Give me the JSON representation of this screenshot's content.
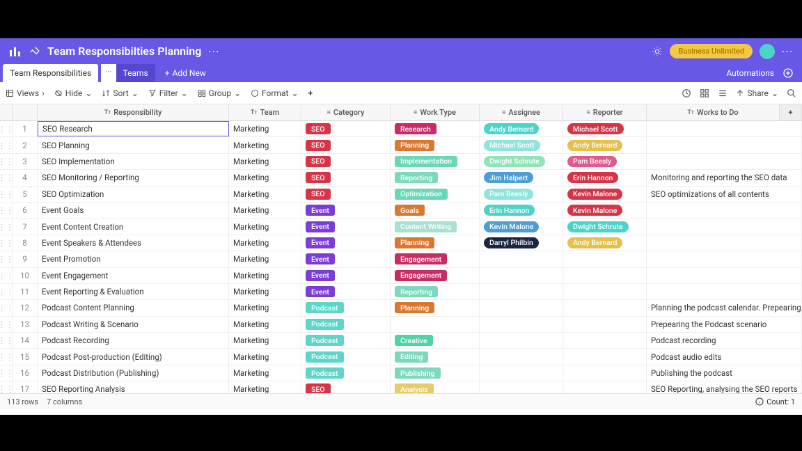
{
  "titlebar": {
    "title": "Team Responsibilties Planning",
    "badge": "Business Unlimited"
  },
  "tabs": {
    "active": "Team Responsibilities",
    "other": "Teams",
    "add_new": "Add New",
    "automations": "Automations"
  },
  "toolbar": {
    "views": "Views",
    "hide": "Hide",
    "sort": "Sort",
    "filter": "Filter",
    "group": "Group",
    "format": "Format",
    "share": "Share"
  },
  "columns": {
    "responsibility": "Responsibility",
    "team": "Team",
    "category": "Category",
    "work_type": "Work Type",
    "assignee": "Assignee",
    "reporter": "Reporter",
    "works": "Works to Do"
  },
  "colors": {
    "seo": "#d63447",
    "event": "#7a3dd8",
    "podcast": "#5cd6c8",
    "research": "#c72c66",
    "planning": "#d97830",
    "implementation": "#6ad8b8",
    "reporting": "#7dd8c0",
    "optimization": "#6ad8b8",
    "goals": "#d97830",
    "contentwriting": "#a8e0d4",
    "engagement": "#c72c66",
    "creative": "#4dd4a8",
    "editing": "#7dd8c0",
    "publishing": "#7dd8c0",
    "analysis": "#e5cc66",
    "p_teal": "#4dd4c8",
    "p_lightteal": "#8fe5dc",
    "p_yellow": "#e5c04d",
    "p_red": "#d63447",
    "p_orange": "#e88a3c",
    "p_blue": "#4d9ed4",
    "p_pink": "#e05a8c",
    "p_navy": "#1a2740",
    "p_lightgreen": "#8fe5b8"
  },
  "rows": [
    {
      "n": "1",
      "resp": "SEO Research",
      "team": "Marketing",
      "category": "SEO",
      "catColor": "seo",
      "workType": "Research",
      "wtColor": "research",
      "assignee": "Andy Bernard",
      "asColor": "p_teal",
      "reporter": "Michael Scott",
      "repColor": "p_red",
      "works": ""
    },
    {
      "n": "2",
      "resp": "SEO Planning",
      "team": "Marketing",
      "category": "SEO",
      "catColor": "seo",
      "workType": "Planning",
      "wtColor": "planning",
      "assignee": "Michael Scott",
      "asColor": "p_lightteal",
      "reporter": "Andy Bernard",
      "repColor": "p_yellow",
      "works": ""
    },
    {
      "n": "3",
      "resp": "SEO Implementation",
      "team": "Marketing",
      "category": "SEO",
      "catColor": "seo",
      "workType": "Implementation",
      "wtColor": "implementation",
      "assignee": "Dwight Schrute",
      "asColor": "p_lightgreen",
      "reporter": "Pam Beesly",
      "repColor": "p_pink",
      "works": ""
    },
    {
      "n": "4",
      "resp": "SEO Monitoring / Reporting",
      "team": "Marketing",
      "category": "SEO",
      "catColor": "seo",
      "workType": "Reporting",
      "wtColor": "reporting",
      "assignee": "Jim Halpert",
      "asColor": "p_blue",
      "reporter": "Erin Hannon",
      "repColor": "p_red",
      "works": "Monitoring and reporting the SEO data"
    },
    {
      "n": "5",
      "resp": "SEO Optimization",
      "team": "Marketing",
      "category": "SEO",
      "catColor": "seo",
      "workType": "Optimization",
      "wtColor": "optimization",
      "assignee": "Pam Beesly",
      "asColor": "p_lightteal",
      "reporter": "Kevin Malone",
      "repColor": "p_red",
      "works": "SEO optimizations of all contents"
    },
    {
      "n": "6",
      "resp": "Event Goals",
      "team": "Marketing",
      "category": "Event",
      "catColor": "event",
      "workType": "Goals",
      "wtColor": "goals",
      "assignee": "Erin Hannon",
      "asColor": "p_teal",
      "reporter": "Kevin Malone",
      "repColor": "p_red",
      "works": ""
    },
    {
      "n": "7",
      "resp": "Event Content Creation",
      "team": "Marketing",
      "category": "Event",
      "catColor": "event",
      "workType": "Content Writing",
      "wtColor": "contentwriting",
      "assignee": "Kevin Malone",
      "asColor": "p_blue",
      "reporter": "Dwight Schrute",
      "repColor": "p_teal",
      "works": ""
    },
    {
      "n": "8",
      "resp": "Event Speakers & Attendees",
      "team": "Marketing",
      "category": "Event",
      "catColor": "event",
      "workType": "Planning",
      "wtColor": "planning",
      "assignee": "Darryl Philbin",
      "asColor": "p_navy",
      "reporter": "Andy Bernard",
      "repColor": "p_yellow",
      "works": ""
    },
    {
      "n": "9",
      "resp": "Event Promotion",
      "team": "Marketing",
      "category": "Event",
      "catColor": "event",
      "workType": "Engagement",
      "wtColor": "engagement",
      "assignee": "",
      "asColor": "",
      "reporter": "",
      "repColor": "",
      "works": ""
    },
    {
      "n": "10",
      "resp": "Event Engagement",
      "team": "Marketing",
      "category": "Event",
      "catColor": "event",
      "workType": "Engagement",
      "wtColor": "engagement",
      "assignee": "",
      "asColor": "",
      "reporter": "",
      "repColor": "",
      "works": ""
    },
    {
      "n": "11",
      "resp": "Event Reporting & Evaluation",
      "team": "Marketing",
      "category": "Event",
      "catColor": "event",
      "workType": "Reporting",
      "wtColor": "reporting",
      "assignee": "",
      "asColor": "",
      "reporter": "",
      "repColor": "",
      "works": ""
    },
    {
      "n": "12",
      "resp": "Podcast Content Planning",
      "team": "Marketing",
      "category": "Podcast",
      "catColor": "podcast",
      "workType": "Planning",
      "wtColor": "planning",
      "assignee": "",
      "asColor": "",
      "reporter": "",
      "repColor": "",
      "works": "Planning the podcast calendar. Prepearing for the new p"
    },
    {
      "n": "13",
      "resp": "Podcast Writing & Scenario",
      "team": "Marketing",
      "category": "Podcast",
      "catColor": "podcast",
      "workType": "",
      "wtColor": "",
      "assignee": "",
      "asColor": "",
      "reporter": "",
      "repColor": "",
      "works": "Prepearing the Podcast scenario"
    },
    {
      "n": "14",
      "resp": "Podcast Recording",
      "team": "Marketing",
      "category": "Podcast",
      "catColor": "podcast",
      "workType": "Creative",
      "wtColor": "creative",
      "assignee": "",
      "asColor": "",
      "reporter": "",
      "repColor": "",
      "works": "Podcast recording"
    },
    {
      "n": "15",
      "resp": "Podcast Post-production (Editing)",
      "team": "Marketing",
      "category": "Podcast",
      "catColor": "podcast",
      "workType": "Editing",
      "wtColor": "editing",
      "assignee": "",
      "asColor": "",
      "reporter": "",
      "repColor": "",
      "works": "Podcast audio edits"
    },
    {
      "n": "16",
      "resp": "Podcast Distribution (Publishing)",
      "team": "Marketing",
      "category": "Podcast",
      "catColor": "podcast",
      "workType": "Publishing",
      "wtColor": "publishing",
      "assignee": "",
      "asColor": "",
      "reporter": "",
      "repColor": "",
      "works": "Publishing the podcast"
    },
    {
      "n": "17",
      "resp": "SEO Reporting Analysis",
      "team": "Marketing",
      "category": "SEO",
      "catColor": "seo",
      "workType": "Analysis",
      "wtColor": "analysis",
      "assignee": "",
      "asColor": "",
      "reporter": "",
      "repColor": "",
      "works": "SEO Reporting, analysing the SEO reports"
    }
  ],
  "footer": {
    "rows": "113 rows",
    "cols": "7 columns",
    "count": "Count: 1"
  }
}
